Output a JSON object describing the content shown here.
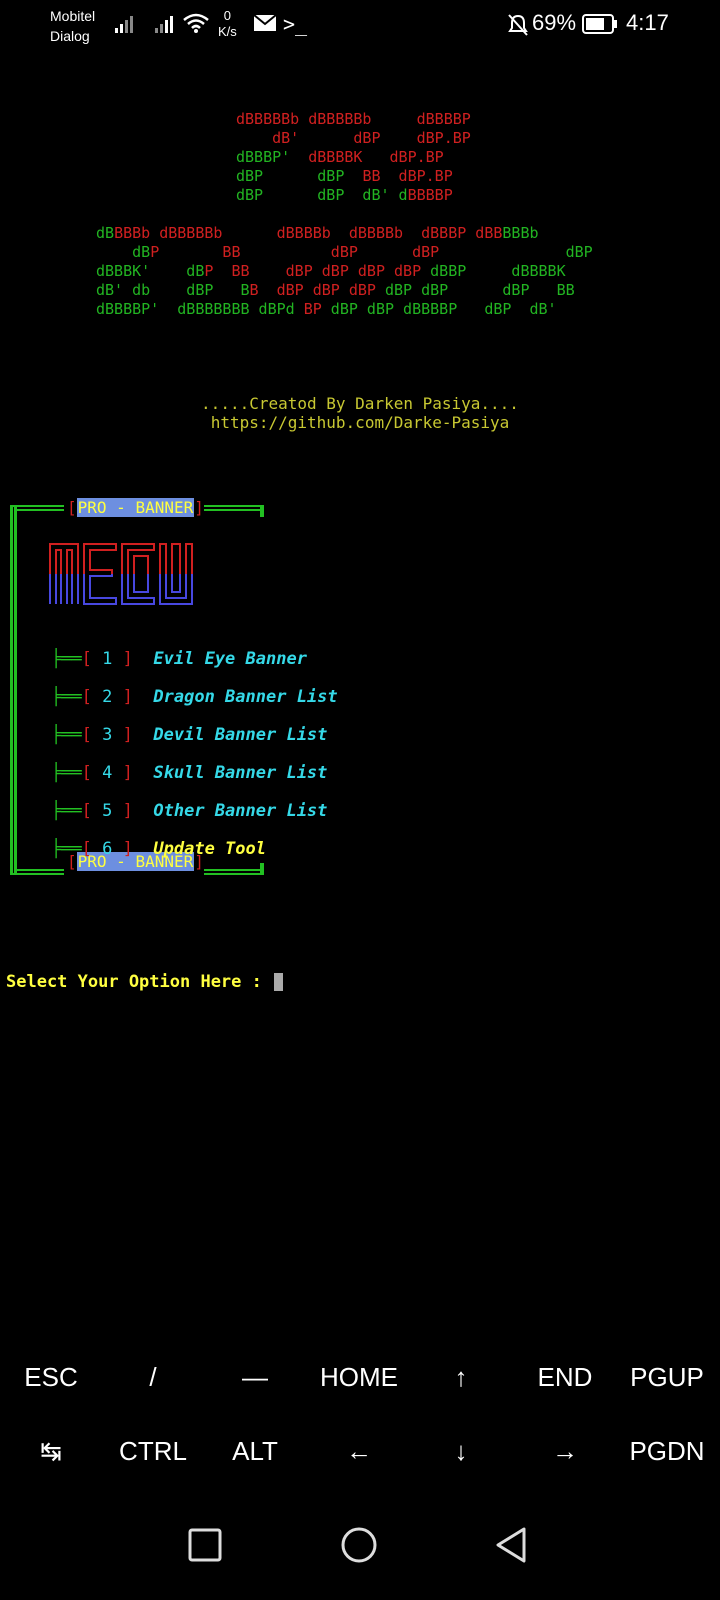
{
  "status_bar": {
    "carrier_1": "Mobitel",
    "carrier_2": "Dialog",
    "net_speed_value": "0",
    "net_speed_unit": "K/s",
    "battery": "69%",
    "time": "4:17"
  },
  "ascii_logo": {
    "word1": [
      [
        [
          "r",
          "dBBBBBb dBBBBBb     dBBBBP"
        ]
      ],
      [
        [
          "r",
          "    dB'      dBP    dBP.BP"
        ]
      ],
      [
        [
          "g",
          "dBBBP'"
        ],
        [
          "r",
          "  dBBBBK   dBP.BP"
        ]
      ],
      [
        [
          "g",
          "dBP      dBP  "
        ],
        [
          "r",
          "BB  dBP.BP"
        ]
      ],
      [
        [
          "g",
          "dBP      dBP  dB' d"
        ],
        [
          "r",
          "BBBBP"
        ]
      ]
    ],
    "word2": [
      [
        [
          "g",
          "dB"
        ],
        [
          "r",
          "BBBb dBBBBBb      dBBBBb  dBBBBb  dBBBP dBB"
        ],
        [
          "g",
          "BBBb"
        ]
      ],
      [
        [
          "g",
          "    dB"
        ],
        [
          "r",
          "P       BB          dBP      dBP"
        ],
        [
          "g",
          "              dBP"
        ]
      ],
      [
        [
          "g",
          "dBBBK'    dB"
        ],
        [
          "r",
          "P  BB    dBP dBP dBP dBP"
        ],
        [
          "g",
          " dBBP     dBBBBK"
        ]
      ],
      [
        [
          "g",
          "dB' db    dBP   B"
        ],
        [
          "r",
          "B  dBP dBP dBP"
        ],
        [
          "g",
          " dBP dBP      dBP   BB"
        ]
      ],
      [
        [
          "g",
          "dBBBBP'  dBBBBBBB dBPd "
        ],
        [
          "r",
          "BP"
        ],
        [
          "g",
          " dBP dBP dBBBBP   dBP  dB'"
        ]
      ]
    ]
  },
  "credit": {
    "line1": ".....Creatod By Darken Pasiya....",
    "line2": "https://github.com/Darke-Pasiya"
  },
  "menu": {
    "header": "PRO - BANNER",
    "footer": "PRO - BANNER",
    "items": [
      {
        "num": "1",
        "label": "Evil Eye Banner"
      },
      {
        "num": "2",
        "label": "Dragon Banner List"
      },
      {
        "num": "3",
        "label": "Devil Banner List"
      },
      {
        "num": "4",
        "label": "Skull Banner List"
      },
      {
        "num": "5",
        "label": "Other Banner List"
      },
      {
        "num": "6",
        "label": "Update Tool"
      }
    ]
  },
  "prompt": "Select Your Option Here :",
  "extra_keys": {
    "row1": [
      "ESC",
      "/",
      "—",
      "HOME",
      "↑",
      "END",
      "PGUP"
    ],
    "row2": [
      "↹",
      "CTRL",
      "ALT",
      "←",
      "↓",
      "→",
      "PGDN"
    ]
  },
  "colors": {
    "green": "#22c022",
    "red": "#d02020",
    "cyan": "#35d9e8",
    "yellow": "#ffff40",
    "highlight": "#6d8fe0",
    "background": "#000000"
  }
}
